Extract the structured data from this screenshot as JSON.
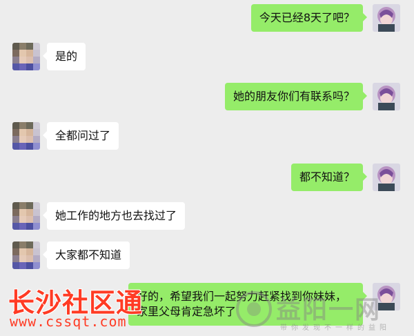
{
  "messages": [
    {
      "side": "me",
      "text": "今天已经8天了吧？"
    },
    {
      "side": "them",
      "text": "是的"
    },
    {
      "side": "me",
      "text": "她的朋友你们有联系吗？"
    },
    {
      "side": "them",
      "text": "全都问过了"
    },
    {
      "side": "me",
      "text": "都不知道？"
    },
    {
      "side": "them",
      "text": "她工作的地方也去找过了"
    },
    {
      "side": "them",
      "text": "大家都不知道"
    },
    {
      "side": "me",
      "line1": "好的，希望我们一起努力赶紧找到你妹妹，",
      "line2": "家里父母肯定急坏了"
    }
  ],
  "watermarks": {
    "left_title": "长沙社区通",
    "left_url": "www.cssqt.com",
    "right_title": "益阳一网",
    "right_sub": "带你发现不一样的益阳"
  },
  "colors": {
    "background": "#ededed",
    "me_bubble": "#95ec69",
    "them_bubble": "#ffffff",
    "watermark_red": "#ff3b24"
  }
}
